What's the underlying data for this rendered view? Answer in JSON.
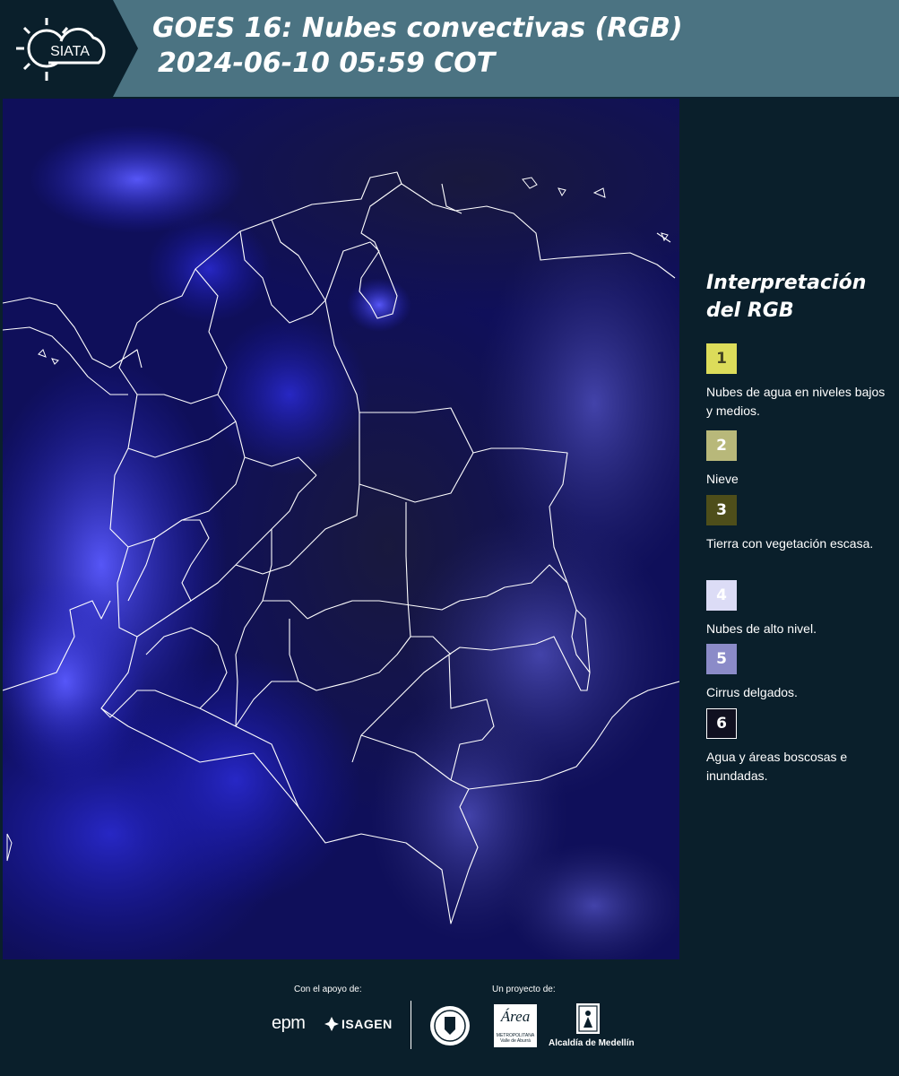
{
  "header": {
    "logo_text": "SIATA",
    "title_line1": "GOES 16: Nubes convectivas (RGB)",
    "title_line2": "2024-06-10 05:59 COT"
  },
  "legend": {
    "title": "Interpretación del RGB",
    "items": [
      {
        "number": "1",
        "label": "Nubes de agua en niveles bajos y medios.",
        "color": "#dcdc5a",
        "number_color": "#444422"
      },
      {
        "number": "2",
        "label": "Nieve",
        "color": "#b8b87a",
        "number_color": "#ffffff"
      },
      {
        "number": "3",
        "label": "Tierra con vegetación escasa.",
        "color": "#4e4e1a",
        "number_color": "#ffffff"
      },
      {
        "number": "4",
        "label": "Nubes de alto nivel.",
        "color": "#dcdcf6",
        "number_color": "#ffffff"
      },
      {
        "number": "5",
        "label": "Cirrus delgados.",
        "color": "#8b8bc8",
        "number_color": "#ffffff"
      },
      {
        "number": "6",
        "label": "Agua y áreas boscosas e inundadas.",
        "color": "#101020",
        "number_color": "#ffffff"
      }
    ]
  },
  "footer": {
    "support_label": "Con el apoyo de:",
    "project_label": "Un proyecto de:",
    "sponsors": {
      "epm": "epm",
      "isagen": "ISAGEN",
      "area": "Área",
      "area_sub1": "METROPOLITANA",
      "area_sub2": "Valle de Aburrá",
      "alcaldia": "Alcaldía de Medellín"
    }
  },
  "colors": {
    "header_bg": "#4b7382",
    "panel_bg": "#0a1f2b",
    "map_base": "#0c0c4a",
    "cloud_bright": "#4a4aff"
  }
}
